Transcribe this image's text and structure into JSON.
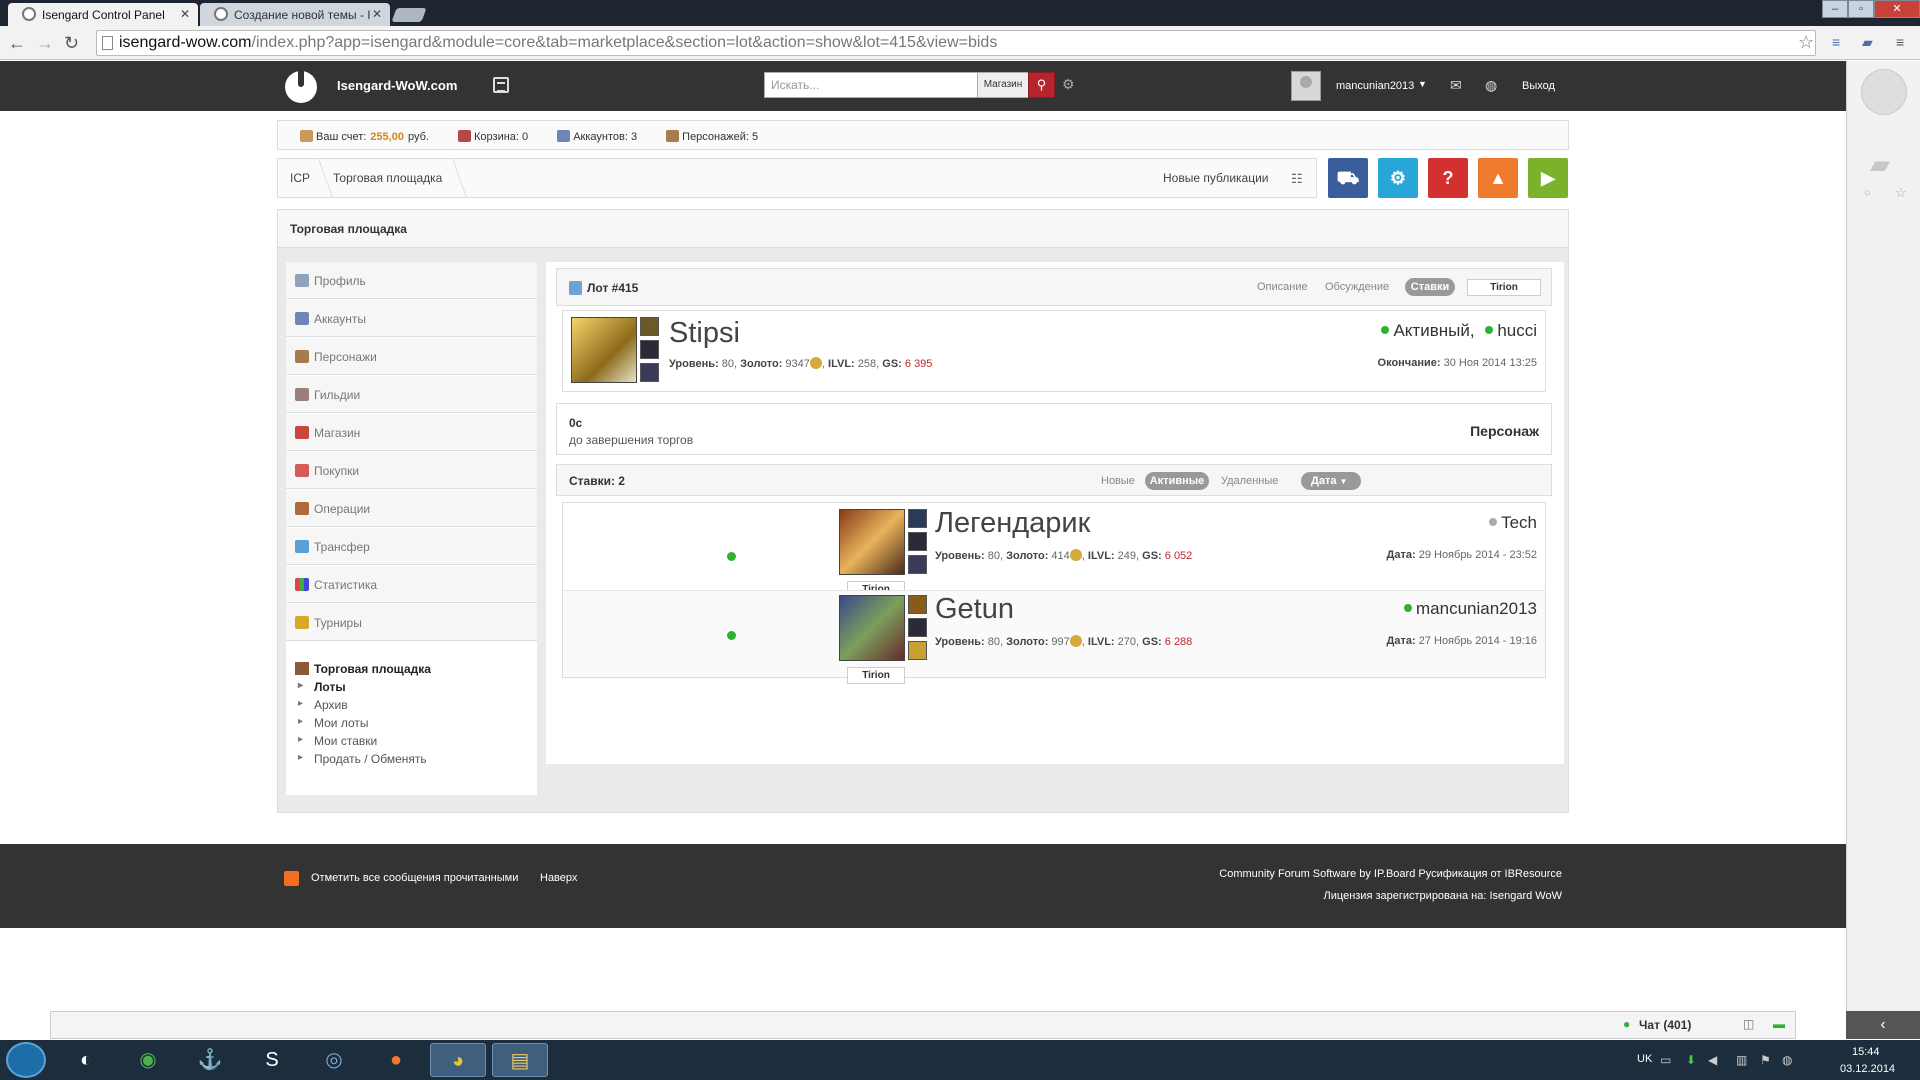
{
  "browser": {
    "tabs": [
      {
        "title": "Isengard Control Panel",
        "active": true
      },
      {
        "title": "Создание новой темы - I",
        "active": false
      }
    ],
    "url_host": "isengard-wow.com",
    "url_path": "/index.php?app=isengard&module=core&tab=marketplace&section=lot&action=show&lot=415&view=bids",
    "icons": [
      "back-arrow-icon",
      "forward-arrow-icon",
      "reload-icon",
      "star-icon"
    ]
  },
  "header": {
    "site_name": "Isengard-WoW.com",
    "search_placeholder": "Искать...",
    "search_scope": "Магазин",
    "username": "mancunian2013",
    "logout": "Выход"
  },
  "infobar": {
    "balance_label": "Ваш счет:",
    "balance_value": "255,00",
    "balance_currency": "руб.",
    "cart": "Корзина: 0",
    "accounts": "Аккаунтов: 3",
    "characters": "Персонажей: 5"
  },
  "breadcrumb": {
    "items": [
      "ICP",
      "Торговая площадка"
    ],
    "new_pubs": "Новые публикации"
  },
  "quick_buttons": [
    {
      "name": "cart-icon",
      "color": "#3a5d9c"
    },
    {
      "name": "gear-icon",
      "color": "#29a6d9"
    },
    {
      "name": "help-icon",
      "color": "#d3302f"
    },
    {
      "name": "thumbs-up-icon",
      "color": "#f07b2c"
    },
    {
      "name": "play-icon",
      "color": "#7cb12b"
    }
  ],
  "main": {
    "title": "Торговая площадка"
  },
  "sidebar": {
    "items": [
      {
        "label": "Профиль",
        "icon": "profile-icon"
      },
      {
        "label": "Аккаунты",
        "icon": "account-icon"
      },
      {
        "label": "Персонажи",
        "icon": "characters-icon"
      },
      {
        "label": "Гильдии",
        "icon": "guild-icon"
      },
      {
        "label": "Магазин",
        "icon": "shop-icon"
      },
      {
        "label": "Покупки",
        "icon": "purchases-icon"
      },
      {
        "label": "Операции",
        "icon": "operations-icon"
      },
      {
        "label": "Трансфер",
        "icon": "transfer-icon"
      },
      {
        "label": "Статистика",
        "icon": "statistics-icon"
      },
      {
        "label": "Турниры",
        "icon": "trophy-icon"
      }
    ],
    "active_section": "Торговая площадка",
    "subitems": [
      "Лоты",
      "Архив",
      "Мои лоты",
      "Мои ставки",
      "Продать / Обменять"
    ]
  },
  "lot": {
    "title": "Лот #415",
    "tabs": [
      "Описание",
      "Обсуждение",
      "Ставки"
    ],
    "active_tab": "Ставки",
    "realm": "Tirion",
    "character": {
      "name": "Stipsi",
      "level_label": "Уровень:",
      "level": "80",
      "gold_label": "Золото:",
      "gold": "9347",
      "ilvl_label": "ILVL:",
      "ilvl": "258",
      "gs_label": "GS:",
      "gs": "6 395",
      "status": "Активный,",
      "seller": "hucci",
      "end_label": "Окончание:",
      "end_value": "30 Ноя 2014 13:25"
    },
    "timer_value": "0с",
    "timer_label": "до завершения торгов",
    "lot_type": "Персонаж"
  },
  "bids": {
    "title": "Ставки: 2",
    "filters": [
      "Новые",
      "Активные",
      "Удаленные"
    ],
    "active_filter": "Активные",
    "sort": "Дата",
    "rows": [
      {
        "name": "Легендарик",
        "level": "80",
        "gold": "414",
        "ilvl": "249",
        "gs": "6 052",
        "owner": "Tech",
        "owner_online": false,
        "date_label": "Дата:",
        "date": "29 Ноябрь 2014 - 23:52",
        "realm": "Tirion"
      },
      {
        "name": "Getun",
        "level": "80",
        "gold": "997",
        "ilvl": "270",
        "gs": "6 288",
        "owner": "mancunian2013",
        "owner_online": true,
        "date_label": "Дата:",
        "date": "27 Ноябрь 2014 - 19:16",
        "realm": "Tirion"
      }
    ]
  },
  "footer": {
    "mark_read": "Отметить все сообщения прочитанными",
    "to_top": "Наверх",
    "credits": "Community Forum Software by IP.Board Русификация от IBResource",
    "license": "Лицензия зарегистрирована на: Isengard WoW"
  },
  "chat": {
    "label": "Чат (401)"
  },
  "taskbar": {
    "lang": "UK",
    "time": "15:44",
    "date": "03.12.2014"
  }
}
